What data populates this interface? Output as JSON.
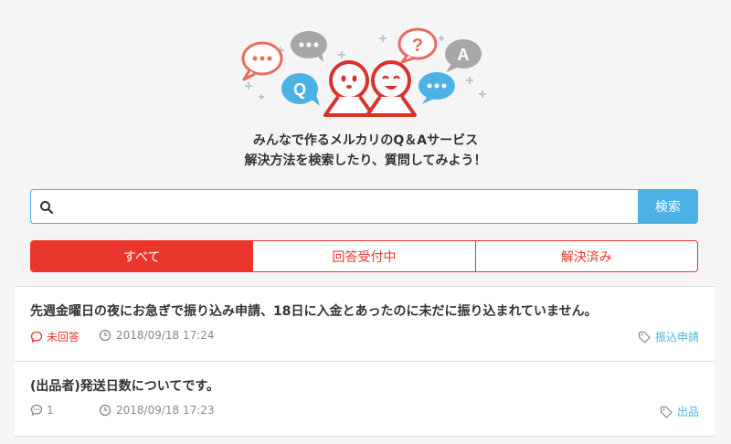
{
  "colors": {
    "accent_red": "#ea352d",
    "accent_blue": "#4cb2e6",
    "bubble_gray": "#aaaaaa",
    "text": "#333333",
    "muted": "#888888"
  },
  "hero": {
    "illustration_icons": [
      "speech-bubble-icon",
      "question-mark-icon",
      "q-bubble-icon",
      "a-bubble-icon",
      "mascot-icon",
      "sparkle-icon"
    ],
    "bubble_q": "Q",
    "bubble_a": "A",
    "bubble_question": "?",
    "tagline_line1": "みんなで作るメルカリのQ＆Aサービス",
    "tagline_line2": "解決方法を検索したり、質問してみよう！"
  },
  "search": {
    "value": "",
    "placeholder": "",
    "button_label": "検索",
    "icon": "search-icon"
  },
  "tabs": [
    {
      "label": "すべて",
      "active": true
    },
    {
      "label": "回答受付中",
      "active": false
    },
    {
      "label": "解決済み",
      "active": false
    }
  ],
  "questions": [
    {
      "title": "先週金曜日の夜にお急ぎで振り込み申請、18日に入金とあったのに未だに振り込まれていません。",
      "status": "未回答",
      "status_icon": "comment-icon",
      "date": "2018/09/18 17:24",
      "date_icon": "clock-icon",
      "tag": "振込申請",
      "tag_icon": "tag-icon"
    },
    {
      "title": "(出品者)発送日数についてです。",
      "status": "1",
      "status_icon": "comments-icon",
      "date": "2018/09/18 17:23",
      "date_icon": "clock-icon",
      "tag": "出品",
      "tag_icon": "tag-icon"
    }
  ]
}
